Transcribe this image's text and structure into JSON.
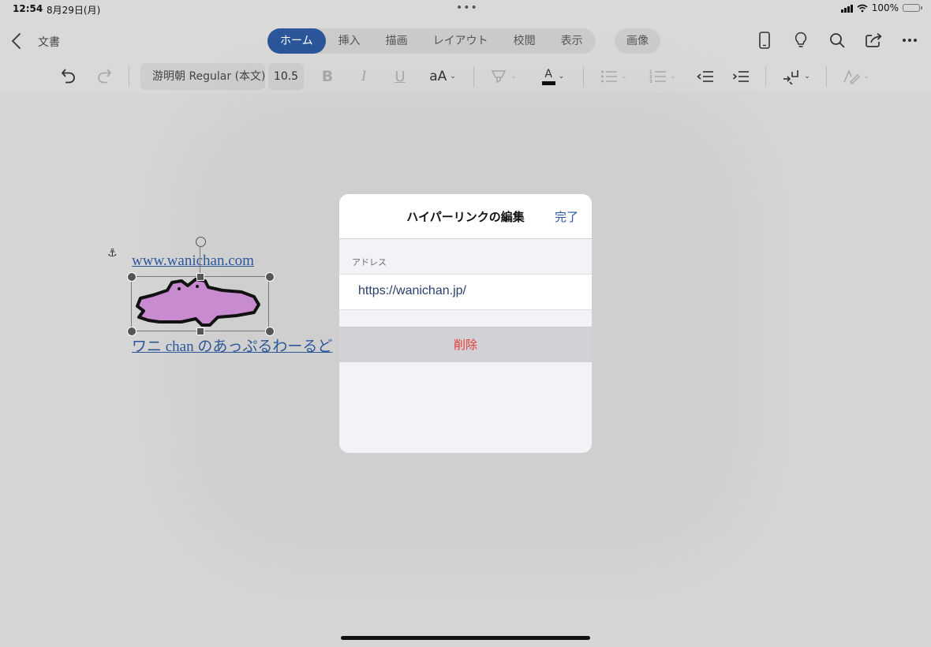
{
  "status": {
    "time": "12:54",
    "date": "8月29日(月)",
    "dots": "•••",
    "battery": "100%"
  },
  "nav": {
    "doc_title": "文書",
    "tabs": [
      "ホーム",
      "挿入",
      "描画",
      "レイアウト",
      "校閲",
      "表示"
    ],
    "active_tab": "ホーム",
    "image_tab": "画像"
  },
  "ribbon": {
    "font_name": "游明朝 Regular (本文)",
    "font_size": "10.5",
    "bold": "B",
    "italic": "I",
    "underline": "U",
    "text_size_label": "aA",
    "font_color_letter": "A"
  },
  "document": {
    "link_url_text": "www.wanichan.com",
    "link_text": "ワニ chan のあっぷるわーるど",
    "anchor_symbol": "⚓"
  },
  "dialog": {
    "title": "ハイパーリンクの編集",
    "done": "完了",
    "address_label": "アドレス",
    "address_value": "https://wanichan.jp/",
    "delete": "削除"
  },
  "colors": {
    "accent": "#2b579a",
    "destructive": "#e53935",
    "croc_fill": "#c98bd0"
  }
}
